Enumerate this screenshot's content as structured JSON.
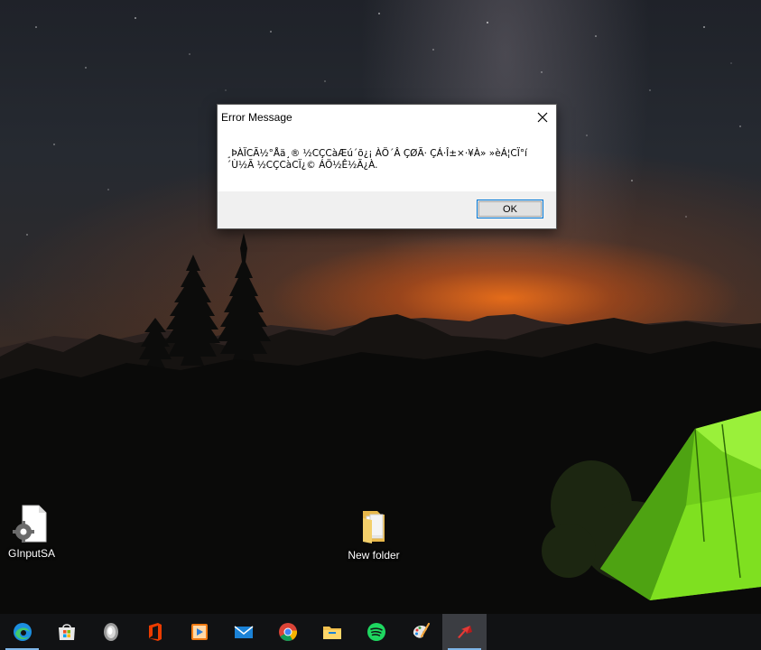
{
  "dialog": {
    "title": "Error Message",
    "message": "¸ÞÀÏCÃ½°Åä¸® ½CÇCàÆú´õ¿¡ ÀÖ´Â ÇØÃ· ÇÁ·Î±×·¥À» »èÁ¦CÏ°í ´Ù½Ã ½CÇCàCÏ¿© ÁÖ½Ê½Ã¿À.",
    "ok_label": "OK",
    "close_icon": "close-icon"
  },
  "desktop": {
    "icons": [
      {
        "label": "GInputSA",
        "icon": "settings-file-icon"
      },
      {
        "label": "New folder",
        "icon": "folder-icon"
      }
    ]
  },
  "taskbar": {
    "items": [
      {
        "name": "edge-icon"
      },
      {
        "name": "microsoft-store-icon"
      },
      {
        "name": "cortana-icon"
      },
      {
        "name": "office-icon"
      },
      {
        "name": "media-player-icon"
      },
      {
        "name": "mail-icon"
      },
      {
        "name": "chrome-icon"
      },
      {
        "name": "file-explorer-icon"
      },
      {
        "name": "spotify-icon"
      },
      {
        "name": "paint-icon"
      },
      {
        "name": "app-icon"
      }
    ]
  },
  "colors": {
    "accent": "#0078d7",
    "tent": "#7fe020",
    "sunset": "#e8701f"
  }
}
